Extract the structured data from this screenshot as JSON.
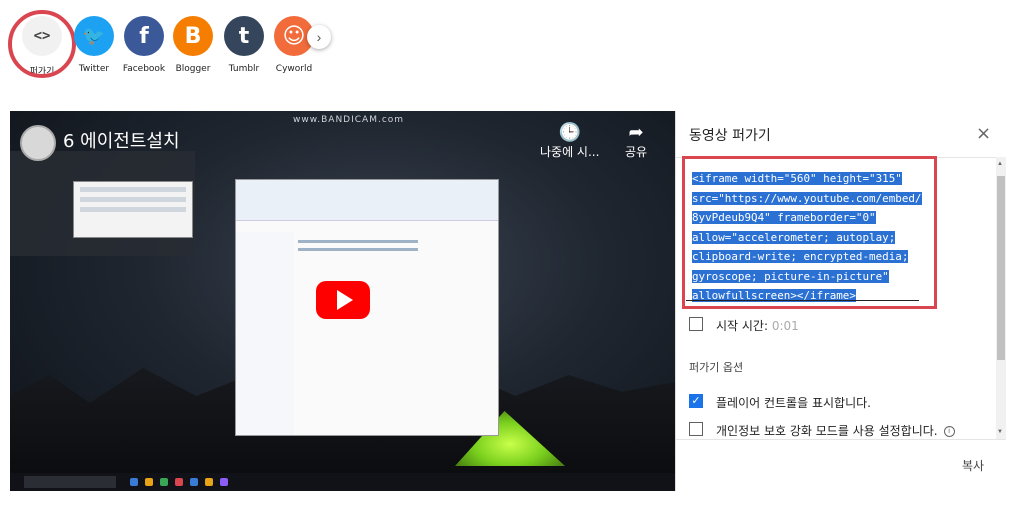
{
  "share_row": {
    "embed": {
      "label": "퍼가기",
      "icon": "<>"
    },
    "items": [
      {
        "label": "Twitter",
        "glyph": "🐦",
        "color": "#1da1f2"
      },
      {
        "label": "Facebook",
        "glyph": "f",
        "color": "#3b5998"
      },
      {
        "label": "Blogger",
        "glyph": "B",
        "color": "#f57d00"
      },
      {
        "label": "Tumblr",
        "glyph": "t",
        "color": "#35465c"
      },
      {
        "label": "Cyworld",
        "glyph": "☺",
        "color": "#f26b3a"
      }
    ],
    "next_icon": "›"
  },
  "video": {
    "watermark": "www.BANDICAM.com",
    "title": "6 에이전트설치",
    "watch_later": {
      "label": "나중에 시...",
      "icon": "clock-icon"
    },
    "share": {
      "label": "공유",
      "icon": "share-arrow-icon"
    }
  },
  "embed_panel": {
    "title": "동영상 퍼가기",
    "close_icon": "×",
    "code_lines": [
      "<iframe width=\"560\" height=\"315\"",
      "src=\"https://www.youtube.com/embed/",
      "8yvPdeub9Q4\" frameborder=\"0\"",
      "allow=\"accelerometer; autoplay;",
      "clipboard-write; encrypted-media;",
      "gyroscope; picture-in-picture\"",
      "allowfullscreen></iframe>"
    ],
    "start_time": {
      "label": "시작 시간:",
      "value": "0:01",
      "checked": false
    },
    "options_heading": "퍼가기 옵션",
    "show_controls": {
      "label": "플레이어 컨트롤을 표시합니다.",
      "checked": true
    },
    "privacy_mode": {
      "label": "개인정보 보호 강화 모드를 사용 설정합니다.",
      "checked": false
    },
    "copy_label": "복사"
  },
  "colors": {
    "highlight": "#d9464f",
    "selection": "#2b71d4",
    "checkbox": "#1a73e8",
    "play": "#ff0000"
  }
}
